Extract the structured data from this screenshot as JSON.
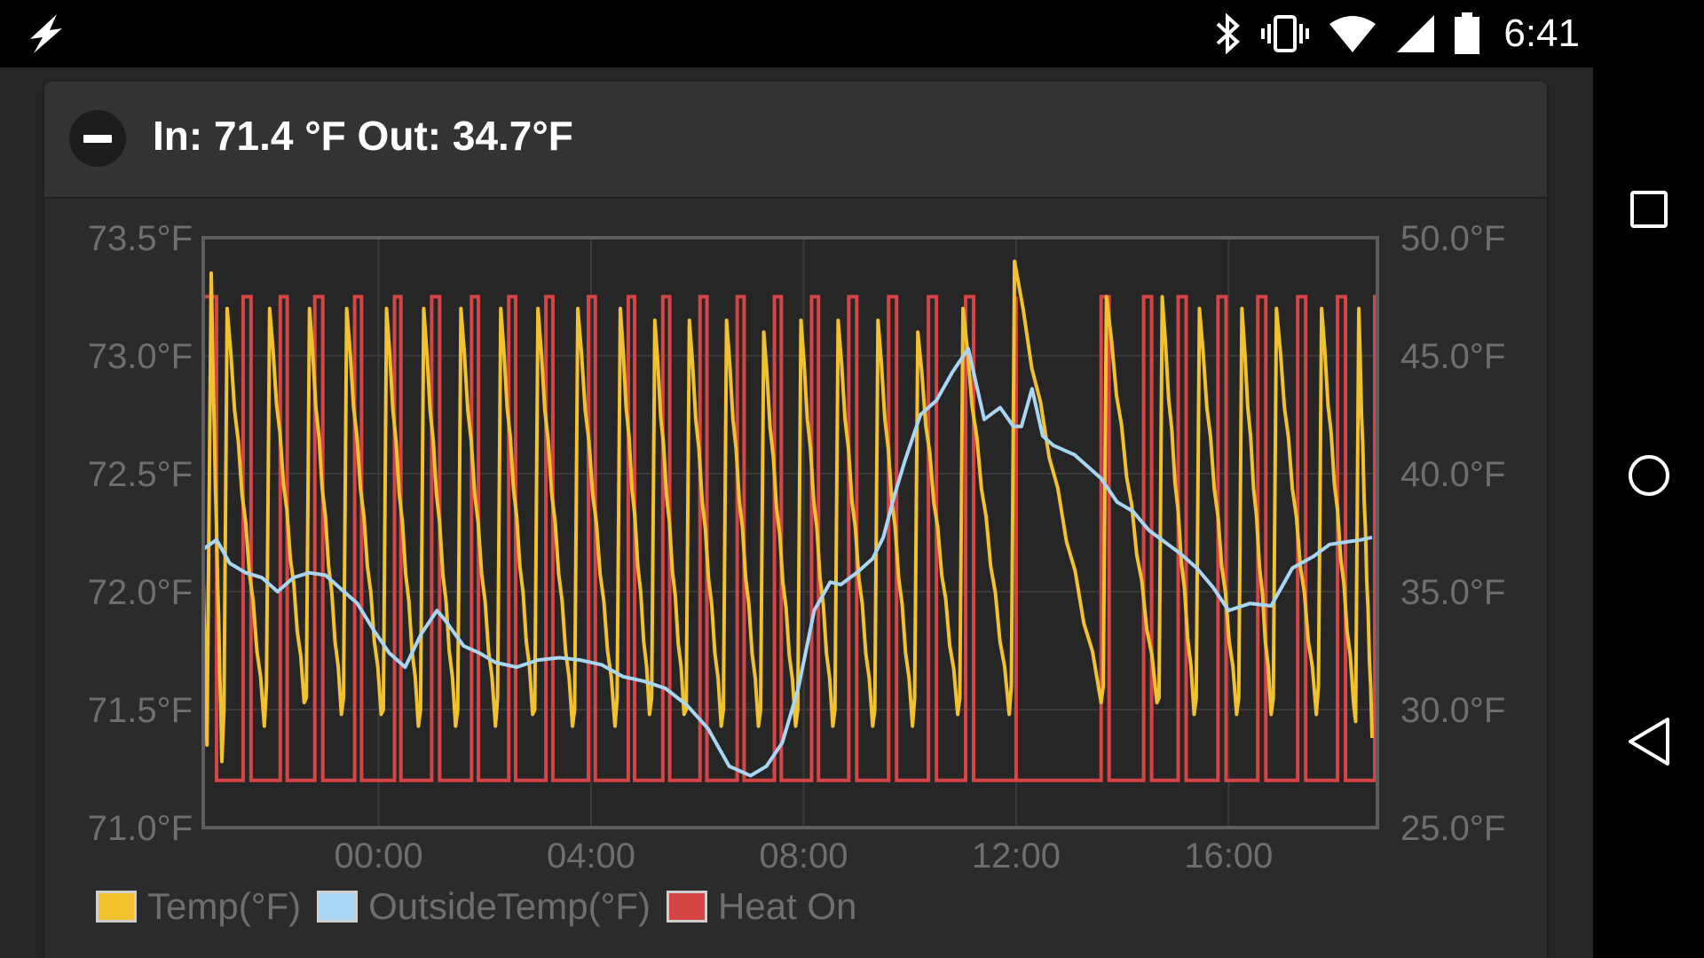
{
  "status_bar": {
    "time": "6:41",
    "icons": [
      "lightning-icon",
      "bluetooth-icon",
      "vibrate-icon",
      "wifi-icon",
      "cell-signal-icon",
      "battery-icon"
    ]
  },
  "nav_bar": {
    "buttons": [
      "recents-square-icon",
      "home-circle-icon",
      "back-triangle-icon"
    ]
  },
  "card": {
    "title": "In: 71.4 °F Out: 34.7°F",
    "collapse_icon": "minus-circle-icon"
  },
  "chart_data": {
    "type": "line",
    "x_ticks": [
      "00:00",
      "04:00",
      "08:00",
      "12:00",
      "16:00"
    ],
    "x_tick_hours": [
      0,
      4,
      8,
      12,
      16
    ],
    "x_range_hours": [
      -3.3,
      18.8
    ],
    "y_left": {
      "ticks": [
        "73.5°F",
        "73.0°F",
        "72.5°F",
        "72.0°F",
        "71.5°F",
        "71.0°F"
      ],
      "range": [
        71.0,
        73.5
      ]
    },
    "y_right": {
      "ticks": [
        "50.0°F",
        "45.0°F",
        "40.0°F",
        "35.0°F",
        "30.0°F",
        "25.0°F"
      ],
      "range": [
        25.0,
        50.0
      ]
    },
    "grid": true,
    "legend_placement": "bottom-left",
    "series": [
      {
        "name": "Temp(°F)",
        "axis": "left",
        "color": "#f2c12e",
        "peak_hours": [
          -3.15,
          -2.85,
          -2.05,
          -1.3,
          -0.6,
          0.15,
          0.85,
          1.55,
          2.3,
          3.0,
          3.75,
          4.55,
          5.2,
          5.85,
          6.55,
          7.25,
          7.95,
          8.65,
          9.4,
          10.15,
          11.0,
          11.97,
          13.7,
          14.75,
          15.45,
          16.25,
          16.9,
          17.75,
          18.45
        ],
        "peak_values": [
          73.35,
          73.2,
          73.2,
          73.2,
          73.2,
          73.2,
          73.2,
          73.2,
          73.2,
          73.2,
          73.2,
          73.2,
          73.15,
          73.15,
          73.15,
          73.1,
          73.15,
          73.15,
          73.15,
          73.1,
          73.2,
          73.4,
          73.25,
          73.25,
          73.2,
          73.2,
          73.2,
          73.2,
          73.2
        ],
        "trough_values": [
          71.3,
          71.45,
          71.55,
          71.5,
          71.5,
          71.45,
          71.45,
          71.45,
          71.5,
          71.45,
          71.45,
          71.5,
          71.5,
          71.45,
          71.45,
          71.45,
          71.45,
          71.45,
          71.45,
          71.5,
          71.5,
          71.55,
          71.55,
          71.5,
          71.5,
          71.5,
          71.5,
          71.55,
          71.4
        ]
      },
      {
        "name": "OutsideTemp(°F)",
        "axis": "right",
        "color": "#a9d6f5",
        "x_hours": [
          -3.3,
          -3.05,
          -2.8,
          -2.5,
          -2.2,
          -1.9,
          -1.6,
          -1.3,
          -1.0,
          -0.7,
          -0.4,
          -0.1,
          0.2,
          0.5,
          0.8,
          1.1,
          1.25,
          1.6,
          1.9,
          2.2,
          2.6,
          3.0,
          3.4,
          3.8,
          4.2,
          4.6,
          5.0,
          5.4,
          5.8,
          6.2,
          6.6,
          7.0,
          7.3,
          7.6,
          7.9,
          8.2,
          8.5,
          8.7,
          9.0,
          9.3,
          9.5,
          9.7,
          9.9,
          10.2,
          10.5,
          10.8,
          11.1,
          11.4,
          11.7,
          11.95,
          12.1,
          12.3,
          12.5,
          12.7,
          12.9,
          13.1,
          13.3,
          13.6,
          13.9,
          14.2,
          14.5,
          14.8,
          15.1,
          15.4,
          15.7,
          16.0,
          16.4,
          16.8,
          17.2,
          17.6,
          17.9,
          18.2,
          18.5,
          18.7
        ],
        "values": [
          36.8,
          37.2,
          36.2,
          35.8,
          35.6,
          35.0,
          35.6,
          35.8,
          35.7,
          35.1,
          34.5,
          33.4,
          32.4,
          31.8,
          33.2,
          34.2,
          33.8,
          32.7,
          32.4,
          32.0,
          31.8,
          32.1,
          32.2,
          32.1,
          31.9,
          31.4,
          31.2,
          30.9,
          30.2,
          29.2,
          27.6,
          27.2,
          27.6,
          28.6,
          30.9,
          34.2,
          35.4,
          35.3,
          35.8,
          36.4,
          37.3,
          39.0,
          40.5,
          42.5,
          43.1,
          44.3,
          45.3,
          42.3,
          42.8,
          42.0,
          42.0,
          43.6,
          41.6,
          41.2,
          41.0,
          40.8,
          40.4,
          39.8,
          38.8,
          38.4,
          37.6,
          37.1,
          36.6,
          36.0,
          35.2,
          34.2,
          34.5,
          34.4,
          36.0,
          36.5,
          37.0,
          37.1,
          37.2,
          37.3
        ],
        "note": ""
      },
      {
        "name": "Heat On",
        "axis": "left",
        "color": "#d64545",
        "states": [
          "on",
          "off"
        ],
        "on_intervals_hours": [
          [
            -3.3,
            -3.05
          ],
          [
            -2.55,
            -2.4
          ],
          [
            -1.85,
            -1.72
          ],
          [
            -1.2,
            -1.05
          ],
          [
            -0.45,
            -0.32
          ],
          [
            0.3,
            0.42
          ],
          [
            1.0,
            1.15
          ],
          [
            1.75,
            1.88
          ],
          [
            2.45,
            2.58
          ],
          [
            3.15,
            3.28
          ],
          [
            3.95,
            4.08
          ],
          [
            4.7,
            4.82
          ],
          [
            5.35,
            5.48
          ],
          [
            6.05,
            6.18
          ],
          [
            6.75,
            6.88
          ],
          [
            7.45,
            7.58
          ],
          [
            8.15,
            8.28
          ],
          [
            8.85,
            9.0
          ],
          [
            9.6,
            9.75
          ],
          [
            10.35,
            10.5
          ],
          [
            11.05,
            11.2
          ],
          [
            12.0,
            12.0
          ],
          [
            13.6,
            13.75
          ],
          [
            14.4,
            14.55
          ],
          [
            15.05,
            15.2
          ],
          [
            15.8,
            15.95
          ],
          [
            16.55,
            16.7
          ],
          [
            17.3,
            17.45
          ],
          [
            18.05,
            18.2
          ],
          [
            18.75,
            18.8
          ]
        ],
        "on_level": 73.25,
        "off_level": 71.2
      }
    ]
  },
  "legend": {
    "items": [
      {
        "label": "Temp(°F)",
        "color": "#f2c12e"
      },
      {
        "label": "OutsideTemp(°F)",
        "color": "#a9d6f5"
      },
      {
        "label": "Heat On",
        "color": "#d64545"
      }
    ]
  }
}
